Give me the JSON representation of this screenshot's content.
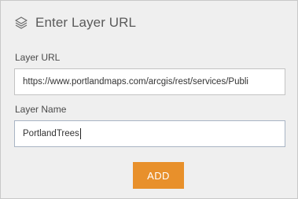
{
  "header": {
    "icon": "layers-icon",
    "title": "Enter Layer URL"
  },
  "form": {
    "url_label": "Layer URL",
    "url_value": "https://www.portlandmaps.com/arcgis/rest/services/Publi",
    "name_label": "Layer Name",
    "name_value": "PortlandTrees"
  },
  "actions": {
    "add_label": "ADD"
  },
  "colors": {
    "accent": "#e8902b",
    "panel_bg": "#efefef",
    "text": "#5a5a5a"
  }
}
